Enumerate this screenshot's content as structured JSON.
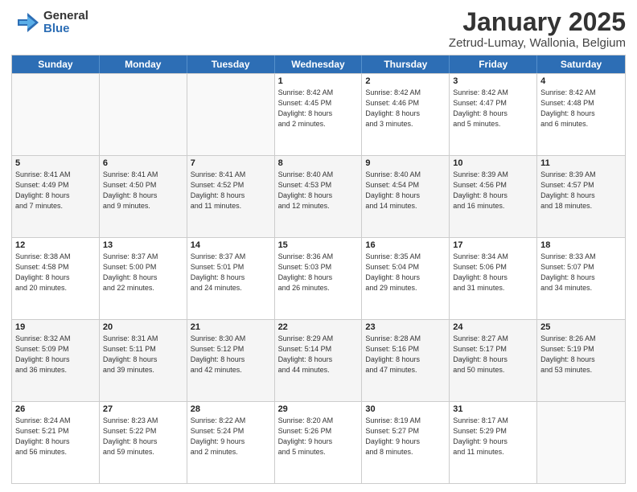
{
  "logo": {
    "general": "General",
    "blue": "Blue"
  },
  "title": {
    "month": "January 2025",
    "location": "Zetrud-Lumay, Wallonia, Belgium"
  },
  "weekdays": [
    "Sunday",
    "Monday",
    "Tuesday",
    "Wednesday",
    "Thursday",
    "Friday",
    "Saturday"
  ],
  "weeks": [
    [
      {
        "day": "",
        "info": "",
        "empty": true
      },
      {
        "day": "",
        "info": "",
        "empty": true
      },
      {
        "day": "",
        "info": "",
        "empty": true
      },
      {
        "day": "1",
        "info": "Sunrise: 8:42 AM\nSunset: 4:45 PM\nDaylight: 8 hours\nand 2 minutes.",
        "empty": false
      },
      {
        "day": "2",
        "info": "Sunrise: 8:42 AM\nSunset: 4:46 PM\nDaylight: 8 hours\nand 3 minutes.",
        "empty": false
      },
      {
        "day": "3",
        "info": "Sunrise: 8:42 AM\nSunset: 4:47 PM\nDaylight: 8 hours\nand 5 minutes.",
        "empty": false
      },
      {
        "day": "4",
        "info": "Sunrise: 8:42 AM\nSunset: 4:48 PM\nDaylight: 8 hours\nand 6 minutes.",
        "empty": false
      }
    ],
    [
      {
        "day": "5",
        "info": "Sunrise: 8:41 AM\nSunset: 4:49 PM\nDaylight: 8 hours\nand 7 minutes.",
        "empty": false
      },
      {
        "day": "6",
        "info": "Sunrise: 8:41 AM\nSunset: 4:50 PM\nDaylight: 8 hours\nand 9 minutes.",
        "empty": false
      },
      {
        "day": "7",
        "info": "Sunrise: 8:41 AM\nSunset: 4:52 PM\nDaylight: 8 hours\nand 11 minutes.",
        "empty": false
      },
      {
        "day": "8",
        "info": "Sunrise: 8:40 AM\nSunset: 4:53 PM\nDaylight: 8 hours\nand 12 minutes.",
        "empty": false
      },
      {
        "day": "9",
        "info": "Sunrise: 8:40 AM\nSunset: 4:54 PM\nDaylight: 8 hours\nand 14 minutes.",
        "empty": false
      },
      {
        "day": "10",
        "info": "Sunrise: 8:39 AM\nSunset: 4:56 PM\nDaylight: 8 hours\nand 16 minutes.",
        "empty": false
      },
      {
        "day": "11",
        "info": "Sunrise: 8:39 AM\nSunset: 4:57 PM\nDaylight: 8 hours\nand 18 minutes.",
        "empty": false
      }
    ],
    [
      {
        "day": "12",
        "info": "Sunrise: 8:38 AM\nSunset: 4:58 PM\nDaylight: 8 hours\nand 20 minutes.",
        "empty": false
      },
      {
        "day": "13",
        "info": "Sunrise: 8:37 AM\nSunset: 5:00 PM\nDaylight: 8 hours\nand 22 minutes.",
        "empty": false
      },
      {
        "day": "14",
        "info": "Sunrise: 8:37 AM\nSunset: 5:01 PM\nDaylight: 8 hours\nand 24 minutes.",
        "empty": false
      },
      {
        "day": "15",
        "info": "Sunrise: 8:36 AM\nSunset: 5:03 PM\nDaylight: 8 hours\nand 26 minutes.",
        "empty": false
      },
      {
        "day": "16",
        "info": "Sunrise: 8:35 AM\nSunset: 5:04 PM\nDaylight: 8 hours\nand 29 minutes.",
        "empty": false
      },
      {
        "day": "17",
        "info": "Sunrise: 8:34 AM\nSunset: 5:06 PM\nDaylight: 8 hours\nand 31 minutes.",
        "empty": false
      },
      {
        "day": "18",
        "info": "Sunrise: 8:33 AM\nSunset: 5:07 PM\nDaylight: 8 hours\nand 34 minutes.",
        "empty": false
      }
    ],
    [
      {
        "day": "19",
        "info": "Sunrise: 8:32 AM\nSunset: 5:09 PM\nDaylight: 8 hours\nand 36 minutes.",
        "empty": false
      },
      {
        "day": "20",
        "info": "Sunrise: 8:31 AM\nSunset: 5:11 PM\nDaylight: 8 hours\nand 39 minutes.",
        "empty": false
      },
      {
        "day": "21",
        "info": "Sunrise: 8:30 AM\nSunset: 5:12 PM\nDaylight: 8 hours\nand 42 minutes.",
        "empty": false
      },
      {
        "day": "22",
        "info": "Sunrise: 8:29 AM\nSunset: 5:14 PM\nDaylight: 8 hours\nand 44 minutes.",
        "empty": false
      },
      {
        "day": "23",
        "info": "Sunrise: 8:28 AM\nSunset: 5:16 PM\nDaylight: 8 hours\nand 47 minutes.",
        "empty": false
      },
      {
        "day": "24",
        "info": "Sunrise: 8:27 AM\nSunset: 5:17 PM\nDaylight: 8 hours\nand 50 minutes.",
        "empty": false
      },
      {
        "day": "25",
        "info": "Sunrise: 8:26 AM\nSunset: 5:19 PM\nDaylight: 8 hours\nand 53 minutes.",
        "empty": false
      }
    ],
    [
      {
        "day": "26",
        "info": "Sunrise: 8:24 AM\nSunset: 5:21 PM\nDaylight: 8 hours\nand 56 minutes.",
        "empty": false
      },
      {
        "day": "27",
        "info": "Sunrise: 8:23 AM\nSunset: 5:22 PM\nDaylight: 8 hours\nand 59 minutes.",
        "empty": false
      },
      {
        "day": "28",
        "info": "Sunrise: 8:22 AM\nSunset: 5:24 PM\nDaylight: 9 hours\nand 2 minutes.",
        "empty": false
      },
      {
        "day": "29",
        "info": "Sunrise: 8:20 AM\nSunset: 5:26 PM\nDaylight: 9 hours\nand 5 minutes.",
        "empty": false
      },
      {
        "day": "30",
        "info": "Sunrise: 8:19 AM\nSunset: 5:27 PM\nDaylight: 9 hours\nand 8 minutes.",
        "empty": false
      },
      {
        "day": "31",
        "info": "Sunrise: 8:17 AM\nSunset: 5:29 PM\nDaylight: 9 hours\nand 11 minutes.",
        "empty": false
      },
      {
        "day": "",
        "info": "",
        "empty": true
      }
    ]
  ]
}
